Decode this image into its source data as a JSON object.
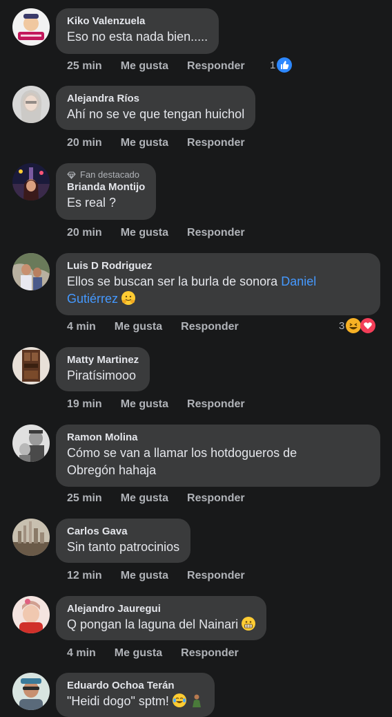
{
  "comments": [
    {
      "name": "Kiko Valenzuela",
      "text": "Eso no esta nada bien.....",
      "time": "25 min",
      "like": "Me gusta",
      "reply": "Responder",
      "reactions": "1",
      "reaction_icons": [
        "like-icon"
      ],
      "avatar_color": "#c2185b"
    },
    {
      "name": "Alejandra Ríos",
      "text": "Ahí no se ve que tengan huichol",
      "time": "20 min",
      "like": "Me gusta",
      "reply": "Responder",
      "avatar_color": "#bfbfbf"
    },
    {
      "badge": "Fan destacado",
      "name": "Brianda Montijo",
      "text": "Es real ?",
      "time": "20 min",
      "like": "Me gusta",
      "reply": "Responder",
      "avatar_color": "#5a2a5a"
    },
    {
      "name": "Luis D Rodriguez",
      "text": "Ellos se buscan ser la burla de sonora",
      "mention": "Daniel Gutiérrez",
      "emoji": "hugging-face",
      "time": "4 min",
      "like": "Me gusta",
      "reply": "Responder",
      "reactions": "3",
      "reaction_icons": [
        "haha-icon",
        "love-icon"
      ],
      "avatar_color": "#8a9080"
    },
    {
      "name": "Matty Martinez",
      "text": "Piratísimooo",
      "time": "19 min",
      "like": "Me gusta",
      "reply": "Responder",
      "avatar_color": "#5a3a28"
    },
    {
      "name": "Ramon Molina",
      "text_lines": [
        "Cómo se van a llamar los hotdogueros de",
        "Obregón hahaja"
      ],
      "time": "25 min",
      "like": "Me gusta",
      "reply": "Responder",
      "avatar_color": "#d0d0d0"
    },
    {
      "name": "Carlos Gava",
      "text": "Sin tanto patrocinios",
      "time": "12 min",
      "like": "Me gusta",
      "reply": "Responder",
      "avatar_color": "#a08a70"
    },
    {
      "name": "Alejandro Jauregui",
      "text": "Q pongan la laguna del Nainari",
      "emoji": "grimacing-face",
      "time": "4 min",
      "like": "Me gusta",
      "reply": "Responder",
      "avatar_color": "#e0a8a0"
    },
    {
      "name": "Eduardo Ochoa Terán",
      "text": "\"Heidi dogo\" sptm!",
      "emoji": "tears-of-joy",
      "avatar_color": "#3a7a9a"
    }
  ]
}
